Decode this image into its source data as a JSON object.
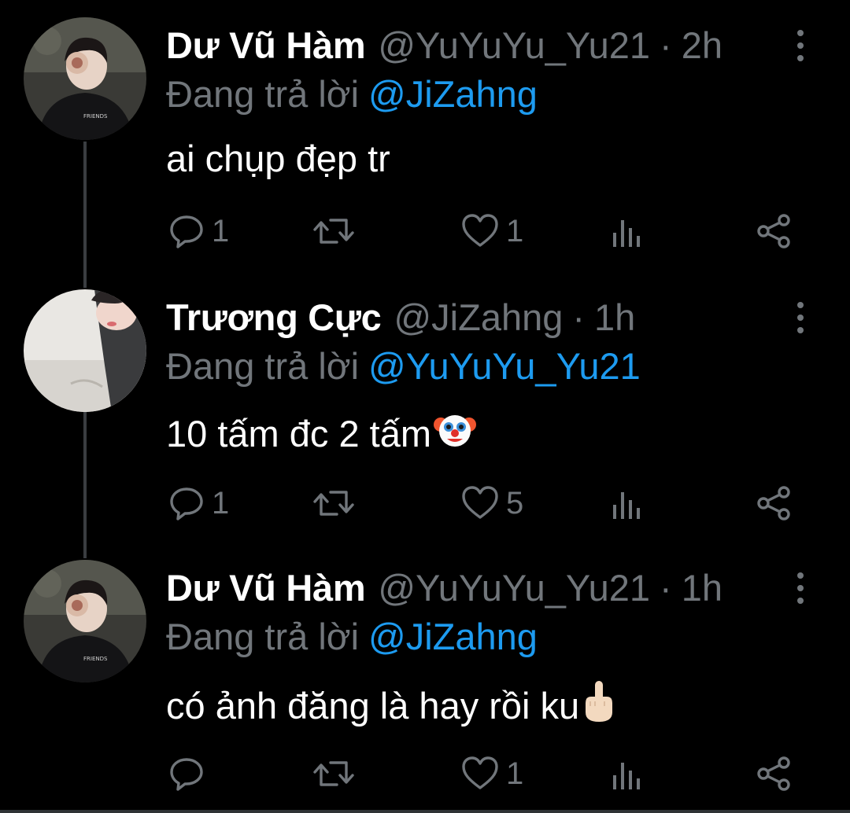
{
  "colors": {
    "background": "#000000",
    "name": "#ffffff",
    "secondary_text": "#71767b",
    "mention": "#1d9bf0",
    "thread_line": "#3a3d41"
  },
  "icons": {
    "more": "vertical-ellipsis-icon",
    "reply": "speech-bubble-icon",
    "retweet": "retweet-arrows-icon",
    "like": "heart-outline-icon",
    "views": "bar-chart-icon",
    "share": "share-nodes-icon"
  },
  "tweets": [
    {
      "name": "Dư Vũ Hàm",
      "handle": "@YuYuYu_Yu21",
      "separator": "·",
      "time": "2h",
      "replying_prefix": "Đang trả lời",
      "replying_to": "@JiZahng",
      "text": "ai chụp đẹp tr",
      "emoji": "",
      "reply_count": "1",
      "retweet_count": "",
      "like_count": "1"
    },
    {
      "name": "Trương Cực",
      "handle": "@JiZahng",
      "separator": "·",
      "time": "1h",
      "replying_prefix": "Đang trả lời",
      "replying_to": "@YuYuYu_Yu21",
      "text": "10 tấm đc 2 tấm",
      "emoji": "clown-face-emoji",
      "reply_count": "1",
      "retweet_count": "",
      "like_count": "5"
    },
    {
      "name": "Dư Vũ Hàm",
      "handle": "@YuYuYu_Yu21",
      "separator": "·",
      "time": "1h",
      "replying_prefix": "Đang trả lời",
      "replying_to": "@JiZahng",
      "text": "có ảnh đăng là hay rồi ku",
      "emoji": "middle-finger-emoji",
      "reply_count": "",
      "retweet_count": "",
      "like_count": "1"
    }
  ]
}
